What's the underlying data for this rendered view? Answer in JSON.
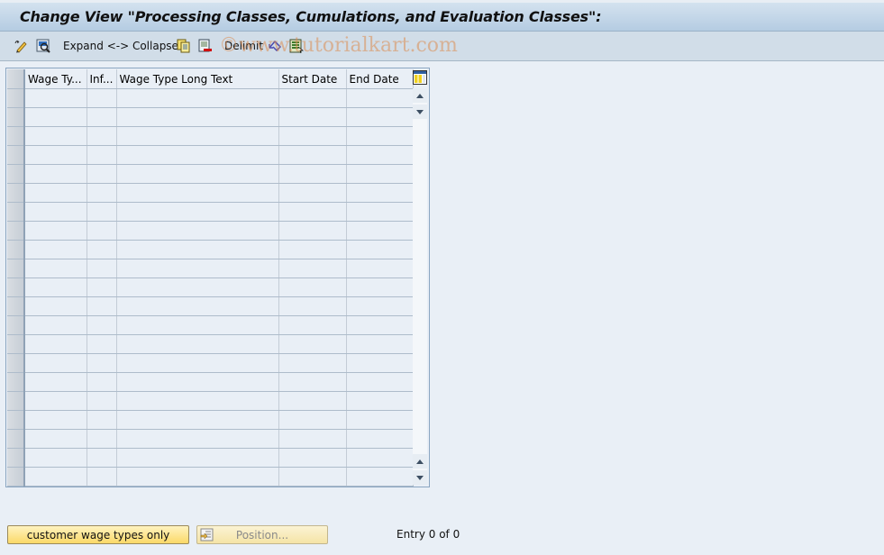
{
  "window": {
    "title": "Change View \"Processing Classes, Cumulations, and Evaluation Classes\":"
  },
  "toolbar": {
    "items": [
      {
        "icon": "display-change-icon"
      },
      {
        "icon": "details-icon"
      },
      {
        "label": "Expand <-> Collapse"
      },
      {
        "icon": "copy-icon"
      },
      {
        "icon": "delete-icon"
      },
      {
        "label": "Delimit"
      },
      {
        "icon": "undo-change-icon"
      },
      {
        "icon": "select-all-icon"
      }
    ],
    "expand_collapse_label": "Expand <-> Collapse",
    "delimit_label": "Delimit"
  },
  "watermark": "©www.tutorialkart.com",
  "table": {
    "columns": [
      "Wage Ty...",
      "Inf...",
      "Wage Type Long Text",
      "Start Date",
      "End Date"
    ],
    "rows": [
      [
        "",
        "",
        "",
        "",
        ""
      ],
      [
        "",
        "",
        "",
        "",
        ""
      ],
      [
        "",
        "",
        "",
        "",
        ""
      ],
      [
        "",
        "",
        "",
        "",
        ""
      ],
      [
        "",
        "",
        "",
        "",
        ""
      ],
      [
        "",
        "",
        "",
        "",
        ""
      ],
      [
        "",
        "",
        "",
        "",
        ""
      ],
      [
        "",
        "",
        "",
        "",
        ""
      ],
      [
        "",
        "",
        "",
        "",
        ""
      ],
      [
        "",
        "",
        "",
        "",
        ""
      ],
      [
        "",
        "",
        "",
        "",
        ""
      ],
      [
        "",
        "",
        "",
        "",
        ""
      ],
      [
        "",
        "",
        "",
        "",
        ""
      ],
      [
        "",
        "",
        "",
        "",
        ""
      ],
      [
        "",
        "",
        "",
        "",
        ""
      ],
      [
        "",
        "",
        "",
        "",
        ""
      ],
      [
        "",
        "",
        "",
        "",
        ""
      ],
      [
        "",
        "",
        "",
        "",
        ""
      ],
      [
        "",
        "",
        "",
        "",
        ""
      ],
      [
        "",
        "",
        "",
        "",
        ""
      ],
      [
        "",
        "",
        "",
        "",
        ""
      ]
    ]
  },
  "footer": {
    "customer_button_label": "customer wage types only",
    "position_button_label": "Position...",
    "entry_status": "Entry 0 of 0"
  }
}
